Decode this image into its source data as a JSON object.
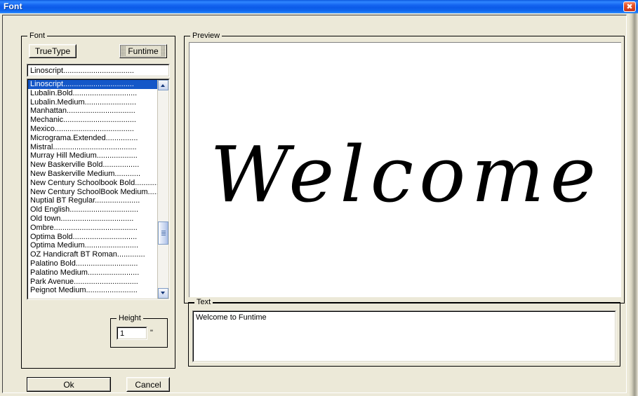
{
  "window": {
    "title": "Font",
    "close_icon": "close-icon",
    "close_glyph": "✖",
    "accent_titlebar": "#1464f0",
    "background": "#ece9d8",
    "selection_color": "#1457c8"
  },
  "font_group": {
    "label": "Font",
    "truetype_button": "TrueType",
    "funtime_button": "Funtime",
    "funtime_checked": true,
    "fontname_value": "Linoscript.................................",
    "selected_index": 0,
    "items": [
      "Linoscript.................................",
      "Lubalin.Bold..............................",
      "Lubalin.Medium........................",
      "Manhattan................................",
      "Mechanic..................................",
      "Mexico.....................................",
      "Micrograma.Extended...............",
      "Mistral.......................................",
      "Murray Hill Medium...................",
      "New Baskerville Bold.................",
      "New Baskerville Medium............",
      "New Century Schoolbook Bold............",
      "New Century SchoolBook Medium.......",
      "Nuptial BT Regular.....................",
      "Old English................................",
      "Old town..................................",
      "Ombre.......................................",
      "Optima Bold..............................",
      "Optima Medium.........................",
      "OZ Handicraft BT Roman.............",
      "Palatino Bold.............................",
      "Palatino Medium........................",
      "Park Avenue..............................",
      "Peignot Medium........................"
    ],
    "scrollbar": {
      "up_icon": "chevron-up-icon",
      "down_icon": "chevron-down-icon",
      "thumb_icon": "scrollbar-thumb"
    }
  },
  "height_group": {
    "label": "Height",
    "value": "1",
    "unit": "\""
  },
  "preview_group": {
    "label": "Preview",
    "preview_text": "Welcome"
  },
  "text_group": {
    "label": "Text",
    "value": "Welcome to Funtime"
  },
  "buttons": {
    "ok": "Ok",
    "cancel": "Cancel"
  }
}
